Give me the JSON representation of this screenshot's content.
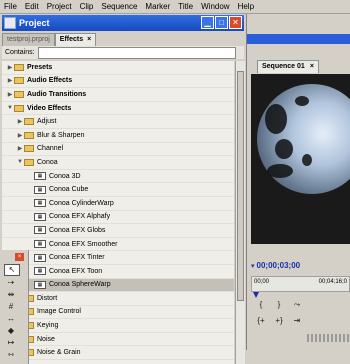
{
  "menu": [
    "File",
    "Edit",
    "Project",
    "Clip",
    "Sequence",
    "Marker",
    "Title",
    "Window",
    "Help"
  ],
  "project_window": {
    "title": "Project",
    "tabs": [
      {
        "label": "testproj.prproj"
      },
      {
        "label": "Effects",
        "close": "×"
      }
    ],
    "contains_label": "Contains:"
  },
  "effects_tree": [
    {
      "label": "Presets",
      "type": "folder",
      "bold": true,
      "expanded": false,
      "indent": 0
    },
    {
      "label": "Audio Effects",
      "type": "folder",
      "bold": true,
      "expanded": false,
      "indent": 0
    },
    {
      "label": "Audio Transitions",
      "type": "folder",
      "bold": true,
      "expanded": false,
      "indent": 0
    },
    {
      "label": "Video Effects",
      "type": "folder",
      "bold": true,
      "expanded": true,
      "indent": 0
    },
    {
      "label": "Adjust",
      "type": "folder",
      "expanded": false,
      "indent": 1
    },
    {
      "label": "Blur & Sharpen",
      "type": "folder",
      "expanded": false,
      "indent": 1
    },
    {
      "label": "Channel",
      "type": "folder",
      "expanded": false,
      "indent": 1
    },
    {
      "label": "Conoa",
      "type": "folder",
      "expanded": true,
      "indent": 1
    },
    {
      "label": "Conoa 3D",
      "type": "effect",
      "indent": 2
    },
    {
      "label": "Conoa Cube",
      "type": "effect",
      "indent": 2
    },
    {
      "label": "Conoa CylinderWarp",
      "type": "effect",
      "indent": 2
    },
    {
      "label": "Conoa EFX Alphafy",
      "type": "effect",
      "indent": 2
    },
    {
      "label": "Conoa EFX Globs",
      "type": "effect",
      "indent": 2
    },
    {
      "label": "Conoa EFX Smoother",
      "type": "effect",
      "indent": 2
    },
    {
      "label": "Conoa EFX Tinter",
      "type": "effect",
      "indent": 2
    },
    {
      "label": "Conoa EFX Toon",
      "type": "effect",
      "indent": 2
    },
    {
      "label": "Conoa SphereWarp",
      "type": "effect",
      "indent": 2,
      "selected": true
    },
    {
      "label": "Distort",
      "type": "folder",
      "expanded": false,
      "indent": 1
    },
    {
      "label": "Image Control",
      "type": "folder",
      "expanded": false,
      "indent": 1
    },
    {
      "label": "Keying",
      "type": "folder",
      "expanded": false,
      "indent": 1
    },
    {
      "label": "Noise",
      "type": "folder",
      "expanded": false,
      "indent": 1
    },
    {
      "label": "Noise & Grain",
      "type": "folder",
      "expanded": false,
      "indent": 1
    }
  ],
  "tools": [
    {
      "name": "selection-tool",
      "glyph": "↖",
      "active": true
    },
    {
      "name": "track-select-tool",
      "glyph": "⇢"
    },
    {
      "name": "ripple-edit-tool",
      "glyph": "⇹"
    },
    {
      "name": "rolling-edit-tool",
      "glyph": "#"
    },
    {
      "name": "rate-stretch-tool",
      "glyph": "↔"
    },
    {
      "name": "razor-tool",
      "glyph": "◆"
    },
    {
      "name": "slip-tool",
      "glyph": "↦"
    },
    {
      "name": "slide-tool",
      "glyph": "⇿"
    }
  ],
  "tool_close": "×",
  "sequence": {
    "tab_label": "Sequence 01",
    "close": "×",
    "timecode": "00;00;03;00",
    "ruler_start": "00;00",
    "ruler_end": "00;04;16;0"
  },
  "transport_glyphs": [
    "{",
    "}",
    "⤳",
    "{+",
    "+}",
    "⇥"
  ],
  "colors": {
    "titlebar": "#1848c0",
    "timecode": "#1a2ea8",
    "close": "#d84a2a"
  }
}
